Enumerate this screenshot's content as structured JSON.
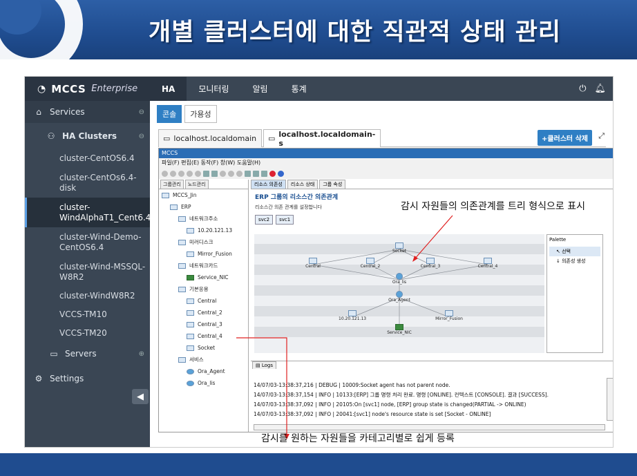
{
  "banner": {
    "title": "개별 클러스터에 대한 직관적 상태 관리"
  },
  "app": {
    "brand": {
      "name": "MCCS",
      "suffix": "Enterprise"
    },
    "topnav": [
      "HA",
      "모니터링",
      "알림",
      "통계"
    ],
    "sidebar": {
      "services": "Services",
      "ha_clusters": "HA Clusters",
      "clusters": [
        {
          "label": "cluster-CentOS6.4"
        },
        {
          "label": "cluster-CentOs6.4-disk"
        },
        {
          "label": "cluster-WindAlphaT1_Cent6.4"
        },
        {
          "label": "cluster-Wind-Demo-CentOS6.4"
        },
        {
          "label": "cluster-Wind-MSSQL-W8R2"
        },
        {
          "label": "cluster-WindW8R2"
        },
        {
          "label": "VCCS-TM10"
        },
        {
          "label": "VCCS-TM20"
        }
      ],
      "servers": "Servers",
      "settings": "Settings"
    },
    "subtabs": [
      "콘솔",
      "가용성"
    ],
    "hosttabs": [
      "localhost.localdomain",
      "localhost.localdomain-s"
    ],
    "delete_button": "+클러스터 삭제",
    "console": {
      "window_title": "MCCS",
      "menu": "파일(F)  편집(E)  동작(F)  창(W)  도움말(H)",
      "left_tabs": [
        "그룹관리",
        "노드관리"
      ],
      "tree": [
        {
          "label": "MCCS_Jin",
          "indent": 0
        },
        {
          "label": "ERP",
          "indent": 1
        },
        {
          "label": "네트워크주소",
          "indent": 2
        },
        {
          "label": "10.20.121.13",
          "indent": 3
        },
        {
          "label": "미러디스크",
          "indent": 2
        },
        {
          "label": "Mirror_Fusion",
          "indent": 3
        },
        {
          "label": "네트워크카드",
          "indent": 2
        },
        {
          "label": "Service_NIC",
          "indent": 3
        },
        {
          "label": "기본응용",
          "indent": 2
        },
        {
          "label": "Central",
          "indent": 3
        },
        {
          "label": "Central_2",
          "indent": 3
        },
        {
          "label": "Central_3",
          "indent": 3
        },
        {
          "label": "Central_4",
          "indent": 3
        },
        {
          "label": "Socket",
          "indent": 3
        },
        {
          "label": "서비스",
          "indent": 2
        },
        {
          "label": "Ora_Agent",
          "indent": 3
        },
        {
          "label": "Ora_lis",
          "indent": 3
        }
      ],
      "center_tabs": [
        "리소스 의존성",
        "리소스 상태",
        "그룹 속성"
      ],
      "graph_title": "ERP 그룹의 리소스간 의존관계",
      "graph_desc": "리소스간 의존 관계를 설정합니다",
      "svc_buttons": [
        "svc2",
        "svc1"
      ],
      "graph_nodes": [
        "Socket",
        "Central",
        "Central_2",
        "Central_3",
        "Central_4",
        "Ora_lis",
        "Ora_Agent",
        "10.20.121.13",
        "Mirror_Fusion",
        "Service_NIC"
      ],
      "palette": {
        "title": "Palette",
        "items": [
          "선택",
          "의존성 생성"
        ]
      },
      "logs_tab": "Logs",
      "log_lines": [
        "14/07/03-13:38:37,216 | DEBUG | 10009:Socket agent has not parent node.",
        "14/07/03-13:38:37,154 | INFO | 10133:[ERP] 그룹 명령 처리 완료. 명령 [ONLINE]. 컨텍스트 [CONSOLE]. 결과 [SUCCESS].",
        "14/07/03-13:38:37,092 | INFO | 20105:On [svc1] node, [ERP] group state is changed(PARTIAL -> ONLINE)",
        "14/07/03-13:38:37,092 | INFO | 20041:[svc1] node's resource state is set [Socket - ONLINE]"
      ]
    }
  },
  "annotations": {
    "tree_view": "감시 자원들의 의존관계를 트리 형식으로 표시",
    "category": "감시를 원하는 자원들을 카테고리별로 쉽게 등록"
  },
  "colors": {
    "accent": "#2f7fc4",
    "annotation_line": "#e02020",
    "banner": "#1f4c8f"
  }
}
